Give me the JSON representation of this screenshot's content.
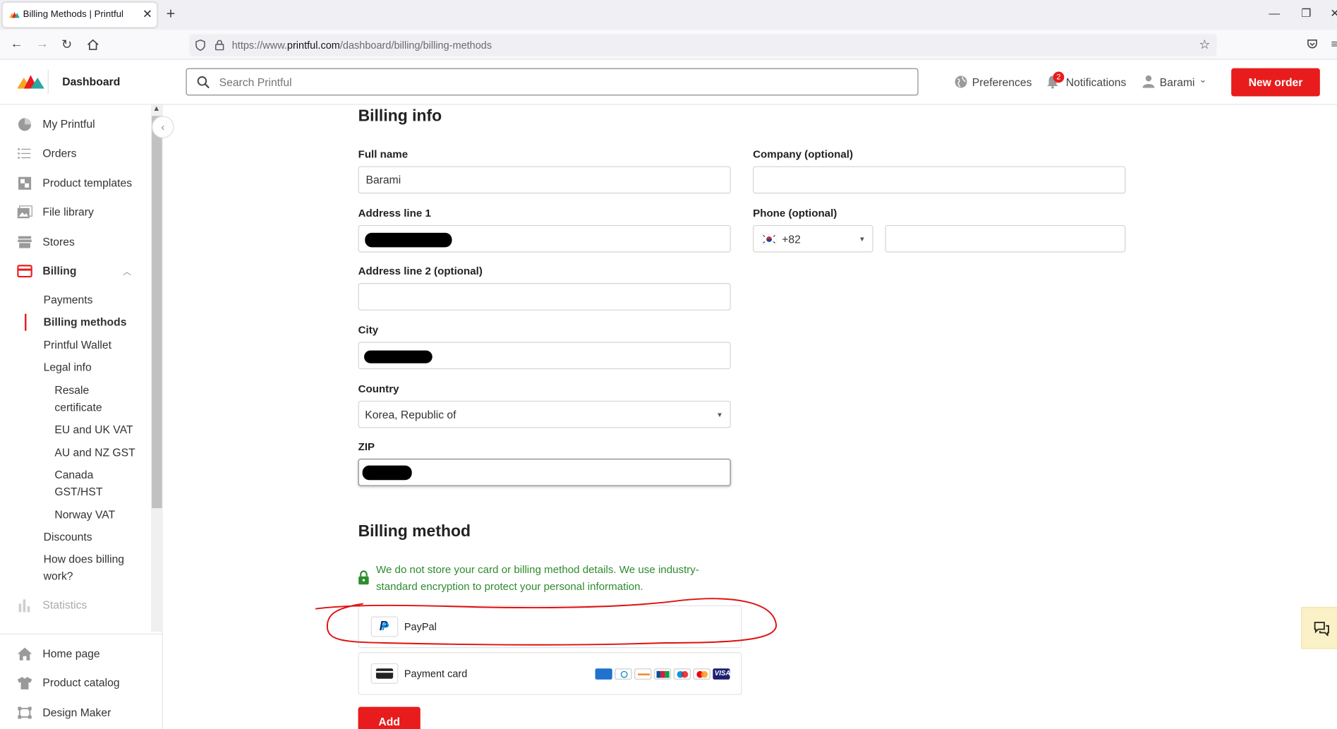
{
  "browser": {
    "tab_title": "Billing Methods | Printful",
    "url_prefix": "https://www.",
    "url_domain": "printful.com",
    "url_path": "/dashboard/billing/billing-methods"
  },
  "header": {
    "brand": "Dashboard",
    "search_placeholder": "Search Printful",
    "preferences": "Preferences",
    "notifications": "Notifications",
    "notifications_count": "2",
    "user": "Barami",
    "new_order": "New order"
  },
  "sidebar": {
    "my_printful": "My Printful",
    "orders": "Orders",
    "product_templates": "Product templates",
    "file_library": "File library",
    "stores": "Stores",
    "billing": "Billing",
    "payments": "Payments",
    "billing_methods": "Billing methods",
    "printful_wallet": "Printful Wallet",
    "legal_info": "Legal info",
    "resale_1": "Resale",
    "resale_2": "certificate",
    "eu_uk_vat": "EU and UK VAT",
    "au_nz_gst": "AU and NZ GST",
    "canada_1": "Canada",
    "canada_2": "GST/HST",
    "norway_vat": "Norway VAT",
    "discounts": "Discounts",
    "how_billing_1": "How does billing",
    "how_billing_2": "work?",
    "statistics": "Statistics",
    "home_page": "Home page",
    "product_catalog": "Product catalog",
    "design_maker": "Design Maker"
  },
  "billing_info": {
    "title": "Billing info",
    "full_name_label": "Full name",
    "full_name_value": "Barami",
    "company_label": "Company (optional)",
    "company_value": "",
    "address1_label": "Address line 1",
    "phone_label": "Phone (optional)",
    "phone_code": "+82",
    "phone_value": "",
    "address2_label": "Address line 2 (optional)",
    "address2_value": "",
    "city_label": "City",
    "country_label": "Country",
    "country_value": "Korea, Republic of",
    "zip_label": "ZIP"
  },
  "billing_method": {
    "title": "Billing method",
    "secure_note": "We do not store your card or billing method details. We use industry-standard encryption to protect your personal information.",
    "options": [
      "PayPal",
      "Payment card"
    ],
    "add_button": "Add"
  },
  "colors": {
    "accent": "#e81c1c",
    "secure_green": "#2e8b2e",
    "annotation_red": "#e01010"
  }
}
